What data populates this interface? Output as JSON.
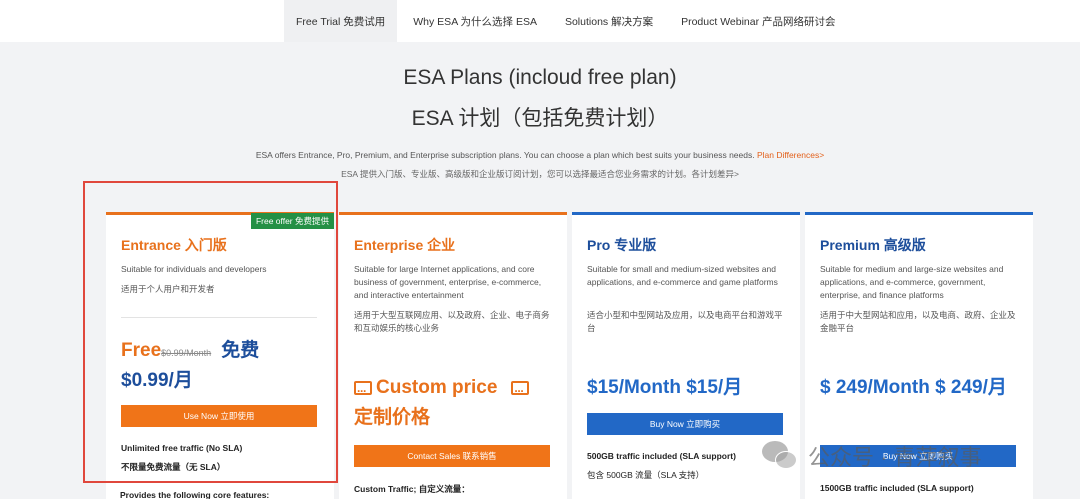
{
  "nav": {
    "items": [
      {
        "label": "Free Trial  免费试用",
        "active": true
      },
      {
        "label": "Why ESA  为什么选择 ESA",
        "active": false
      },
      {
        "label": "Solutions  解决方案",
        "active": false
      },
      {
        "label": "Product Webinar  产品网络研讨会",
        "active": false
      }
    ]
  },
  "header": {
    "title_en": "ESA Plans (incloud free plan)",
    "title_zh": "ESA 计划（包括免费计划）",
    "desc_en": "ESA offers Entrance, Pro, Premium, and Enterprise subscription plans. You can choose a plan which best suits your business needs.",
    "desc_link": "Plan Differences>",
    "desc_zh": "ESA 提供入门版、专业版、高级版和企业版订阅计划，您可以选择最适合您业务需求的计划。各计划差异>"
  },
  "cards": {
    "entrance": {
      "badge": "Free offer  免费提供",
      "title": "Entrance  入门版",
      "desc": "Suitable for individuals and developers",
      "desc_zh": "适用于个人用户和开发者",
      "price_free": "Free",
      "price_strike": "$0.99/Month",
      "price_free_zh": "免费",
      "price_line2": "$0.99/月",
      "button": "Use Now  立即使用",
      "feature1": "Unlimited free traffic (No SLA)",
      "feature2": "不限量免费流量（无 SLA）"
    },
    "enterprise": {
      "title": "Enterprise  企业",
      "desc": "Suitable for large Internet applications, and core business of government, enterprise, e-commerce, and interactive entertainment",
      "desc_zh": "适用于大型互联网应用、以及政府、企业、电子商务和互动娱乐的核心业务",
      "price": "Custom price",
      "price_zh": "定制价格",
      "button": "Contact Sales  联系销售",
      "feature1": "Custom Traffic;  自定义流量："
    },
    "pro": {
      "title": "Pro  专业版",
      "desc": "Suitable for small and medium-sized websites and applications, and e-commerce and game platforms",
      "desc_zh": "适合小型和中型网站及应用，以及电商平台和游戏平台",
      "price": "$15/Month  $15/月",
      "button": "Buy Now  立即购买",
      "feature1": "500GB traffic included (SLA support)",
      "feature2": "包含 500GB 流量（SLA 支持）"
    },
    "premium": {
      "title": "Premium  高级版",
      "desc": "Suitable for medium and large-size websites and applications, and e-commerce, government, enterprise, and finance platforms",
      "desc_zh": "适用于中大型网站和应用，以及电商、政府、企业及金融平台",
      "price": "$ 249/Month  $ 249/月",
      "button": "Buy Now  立即购买",
      "feature1": "1500GB traffic included (SLA support)"
    }
  },
  "below": {
    "text": "Provides the following core features:"
  },
  "watermark": {
    "text": "公众号 · 青萍叙事"
  },
  "colors": {
    "orange": "#e8711c",
    "blue": "#2268c6",
    "navy": "#1d4e9b",
    "green_badge": "#249045",
    "highlight_red": "#e0473c"
  }
}
